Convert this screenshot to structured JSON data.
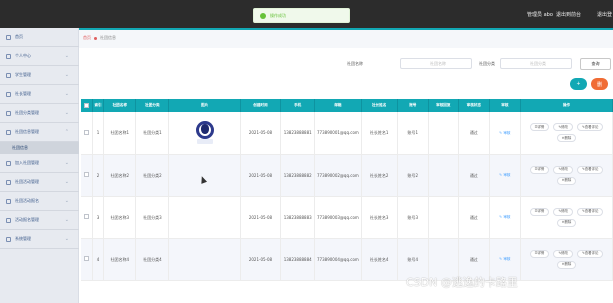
{
  "topbar": {
    "user": "管理员 abo",
    "logout": "退出到前台",
    "logout2": "退出登"
  },
  "toast": {
    "text": "操作成功"
  },
  "sidebar": {
    "items": [
      {
        "label": "首页"
      },
      {
        "label": "个人中心"
      },
      {
        "label": "学生管理"
      },
      {
        "label": "社长管理"
      },
      {
        "label": "社团分类管理"
      },
      {
        "label": "社团信息管理"
      },
      {
        "label": "加入社团管理"
      },
      {
        "label": "社团活动管理"
      },
      {
        "label": "社团活动报名"
      },
      {
        "label": "活动报名管理"
      },
      {
        "label": "系统管理"
      }
    ],
    "sub": "社团信息"
  },
  "breadcrumb": {
    "home": "首页",
    "current": "社团信息"
  },
  "search": {
    "name_label": "社团名称",
    "name_placeholder": "社团名称",
    "type_label": "社团分类",
    "type_placeholder": "社团分类",
    "button": "查询"
  },
  "actions": {
    "add": "+",
    "delete": "删"
  },
  "table": {
    "headers": [
      "索引",
      "社团名称",
      "社团分类",
      "图片",
      "创建时间",
      "手机",
      "邮箱",
      "社长姓名",
      "账号",
      "审核回复",
      "审核状态",
      "审核",
      "操作"
    ],
    "rows": [
      {
        "idx": "1",
        "name": "社团名称1",
        "type": "社团分类1",
        "date": "2021-05-08",
        "phone": "13823888881",
        "email": "773890001@qq.com",
        "leader": "社长姓名1",
        "acct": "账号1",
        "reply": "",
        "status": "通过",
        "audit": "审核"
      },
      {
        "idx": "2",
        "name": "社团名称2",
        "type": "社团分类2",
        "date": "2021-05-08",
        "phone": "13823888882",
        "email": "773890002@qq.com",
        "leader": "社长姓名2",
        "acct": "账号2",
        "reply": "",
        "status": "通过",
        "audit": "审核"
      },
      {
        "idx": "3",
        "name": "社团名称3",
        "type": "社团分类3",
        "date": "2021-05-08",
        "phone": "13823888883",
        "email": "773890003@qq.com",
        "leader": "社长姓名3",
        "acct": "账号3",
        "reply": "",
        "status": "通过",
        "audit": "审核"
      },
      {
        "idx": "4",
        "name": "社团名称4",
        "type": "社团分类4",
        "date": "2021-05-08",
        "phone": "13823888884",
        "email": "773890004@qq.com",
        "leader": "社长姓名4",
        "acct": "账号4",
        "reply": "",
        "status": "通过",
        "audit": "审核"
      }
    ],
    "ops": {
      "detail": "详情",
      "edit": "修改",
      "view_review": "查看评论",
      "delete": "删除"
    }
  },
  "watermark": "CSDN @逃逸的卡路里"
}
